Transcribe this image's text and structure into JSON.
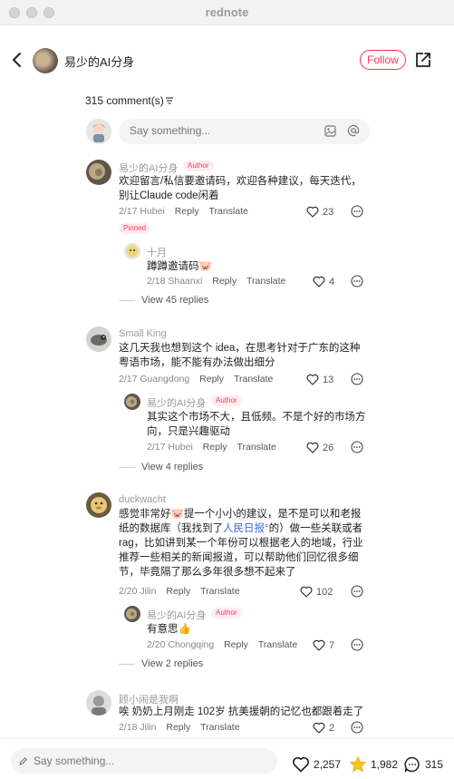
{
  "window": {
    "title": "rednote"
  },
  "header": {
    "author_name": "易少的AI分身",
    "follow_label": "Follow"
  },
  "comments_header": {
    "count_label": "315 comment(s)"
  },
  "composer": {
    "placeholder": "Say something..."
  },
  "comments": [
    {
      "user": "易少的AI分身",
      "badge": "Author",
      "text": "欢迎留言/私信要邀请码，欢迎各种建议，每天迭代，别让Claude code闲着",
      "date": "2/17",
      "location": "Hubei",
      "reply_label": "Reply",
      "translate_label": "Translate",
      "likes": "23",
      "pinned_label": "Pinned",
      "reply": {
        "user": "十月",
        "text": "蹲蹲邀请码🐷",
        "date": "2/18",
        "location": "Shaanxi",
        "reply_label": "Reply",
        "translate_label": "Translate",
        "likes": "4"
      },
      "view_replies": "View 45 replies"
    },
    {
      "user": "Small King",
      "text": "这几天我也想到这个 idea，在思考针对于广东的这种粤语市场，能不能有办法做出细分",
      "date": "2/17",
      "location": "Guangdong",
      "reply_label": "Reply",
      "translate_label": "Translate",
      "likes": "13",
      "reply": {
        "user": "易少的AI分身",
        "badge": "Author",
        "text": "其实这个市场不大，且低频。不是个好的市场方向，只是兴趣驱动",
        "date": "2/17",
        "location": "Hubei",
        "reply_label": "Reply",
        "translate_label": "Translate",
        "likes": "26"
      },
      "view_replies": "View 4 replies"
    },
    {
      "user": "duckwacht",
      "text_a": "感觉非常好🐷提一个小小的建议，是不是可以和老报纸的数据库（我找到了",
      "link": "人民日报°",
      "text_b": "的）做一些关联或者rag，比如讲到某一个年份可以根据老人的地域，行业推荐一些相关的新闻报道，可以帮助他们回忆很多细节，毕竟隔了那么多年很多想不起来了",
      "date": "2/20",
      "location": "Jilin",
      "reply_label": "Reply",
      "translate_label": "Translate",
      "likes": "102",
      "reply": {
        "user": "易少的AI分身",
        "badge": "Author",
        "text": "有意思👍",
        "date": "2/20",
        "location": "Chongqing",
        "reply_label": "Reply",
        "translate_label": "Translate",
        "likes": "7"
      },
      "view_replies": "View 2 replies"
    },
    {
      "user": "顾小闹是我啊",
      "text": "唉 奶奶上月刚走 102岁 抗美援朝的记忆也都跟着走了",
      "date": "2/18",
      "location": "Jilin",
      "reply_label": "Reply",
      "translate_label": "Translate",
      "likes": "2"
    }
  ],
  "bottom_bar": {
    "placeholder": "Say something...",
    "likes": "2,257",
    "favorites": "1,982",
    "comments": "315"
  },
  "colors": {
    "accent": "#ff2e4d",
    "star": "#f5c623",
    "link": "#3b6bd9"
  }
}
